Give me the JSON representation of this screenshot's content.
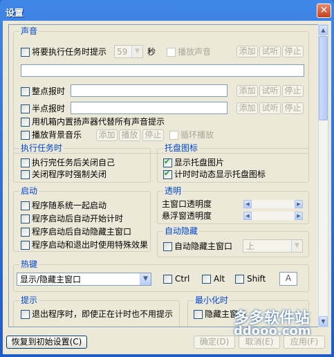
{
  "window": {
    "title": "设置",
    "close_glyph": "✕"
  },
  "sound": {
    "title": "声音",
    "task_remind_label": "将要执行任务时提示",
    "task_remind_seconds": "59",
    "seconds_unit": "秒",
    "play_sound_label": "播放声音",
    "path_value": "",
    "hourly_label": "整点报时",
    "half_hour_label": "半点报时",
    "internal_speaker_label": "用机箱内置扬声器代替所有声音提示",
    "bgm_label": "播放背景音乐",
    "add": "添加",
    "listen": "试听",
    "stop": "停止",
    "play": "播放",
    "loop_label": "循环播放"
  },
  "task": {
    "title": "执行任务时",
    "close_self": "执行完任务后关闭自己",
    "force_close": "关闭程序时强制关闭"
  },
  "tray": {
    "title": "托盘图标",
    "show_tray": "显示托盘图片",
    "dynamic_tray": "计时时动态显示托盘图标"
  },
  "startup": {
    "title": "启动",
    "with_system": "程序随系统一起启动",
    "auto_timer": "程序启动后自动开始计时",
    "auto_hide": "程序启动后自动隐藏主窗口",
    "special_effect": "程序启动和退出时使用特殊效果"
  },
  "transparency": {
    "title": "透明",
    "main_label": "主窗口透明度",
    "float_label": "悬浮窗透明度"
  },
  "autohide": {
    "title": "自动隐藏",
    "label": "自动隐藏主窗口",
    "position": "上"
  },
  "hotkey": {
    "title": "热键",
    "action": "显示/隐藏主窗口",
    "ctrl": "Ctrl",
    "alt": "Alt",
    "shift": "Shift",
    "key": "A"
  },
  "tips": {
    "title": "提示",
    "exit_tip": "退出程序时，即使正在计时也不用提示"
  },
  "minimize": {
    "title": "最小化时",
    "label": "隐藏主窗口"
  },
  "footer": {
    "reset": "恢复到初始设置(C)",
    "ok": "确定(D)",
    "cancel": "取消(E)",
    "apply": "应用(F)"
  },
  "watermark": {
    "brand": "多多软件站",
    "url": "ddooo.com"
  }
}
